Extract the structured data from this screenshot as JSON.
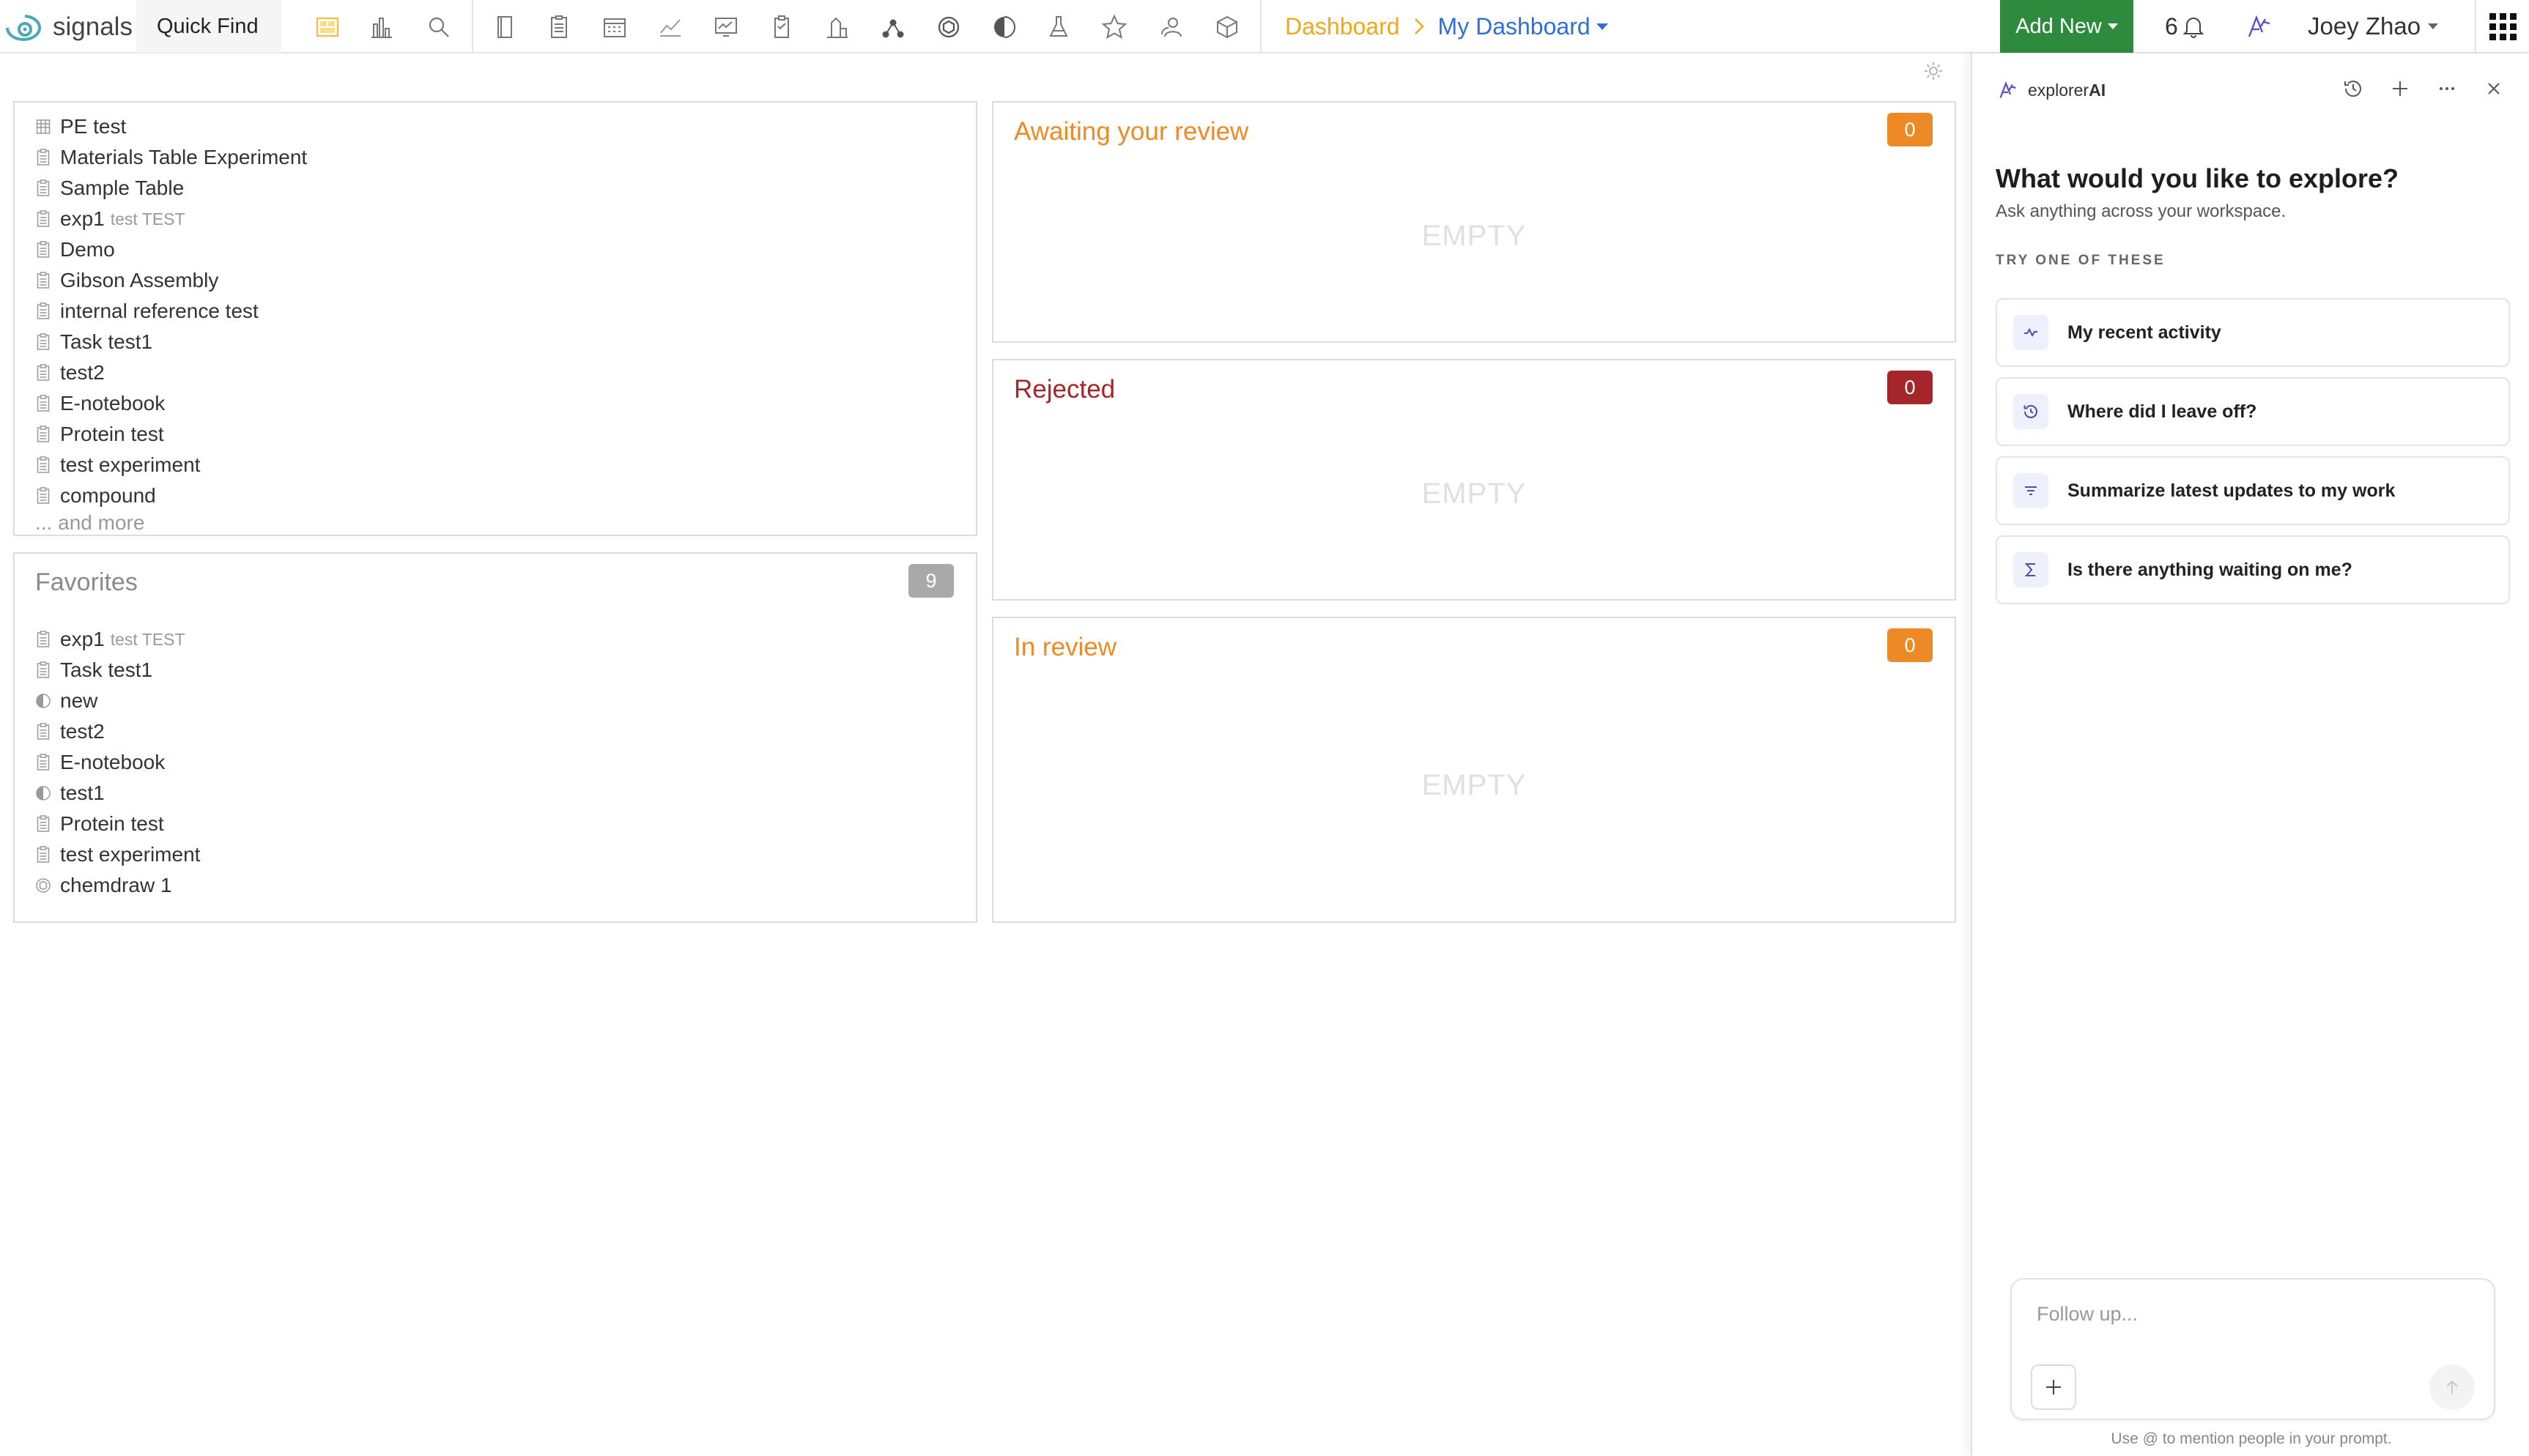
{
  "nav": {
    "brand": "signals",
    "quick_find": "Quick Find",
    "tools": [
      "dashboard-icon",
      "charts-icon",
      "search-icon",
      "notebook-icon",
      "experiment-icon",
      "calendar-icon",
      "analysis-icon",
      "presentation-icon",
      "clipboard-icon",
      "lab-icon",
      "network-icon",
      "chemistry-icon",
      "materials-icon",
      "flask-icon",
      "favorites-icon",
      "users-icon",
      "package-icon"
    ],
    "breadcrumb_root": "Dashboard",
    "breadcrumb_current": "My Dashboard",
    "add_new": "Add New",
    "notification_count": "6",
    "user_name": "Joey Zhao"
  },
  "recent": {
    "items": [
      {
        "label": "PE test",
        "sub": "",
        "icon": "table-icon"
      },
      {
        "label": "Materials Table Experiment",
        "sub": "",
        "icon": "experiment-icon"
      },
      {
        "label": "Sample Table",
        "sub": "",
        "icon": "experiment-icon"
      },
      {
        "label": "exp1",
        "sub": "test TEST",
        "icon": "experiment-icon"
      },
      {
        "label": "Demo",
        "sub": "",
        "icon": "experiment-icon"
      },
      {
        "label": "Gibson Assembly",
        "sub": "",
        "icon": "experiment-icon"
      },
      {
        "label": "internal reference test",
        "sub": "",
        "icon": "experiment-icon"
      },
      {
        "label": "Task test1",
        "sub": "",
        "icon": "experiment-icon"
      },
      {
        "label": "test2",
        "sub": "",
        "icon": "experiment-icon"
      },
      {
        "label": "E-notebook",
        "sub": "",
        "icon": "experiment-icon"
      },
      {
        "label": "Protein test",
        "sub": "",
        "icon": "experiment-icon"
      },
      {
        "label": "test experiment",
        "sub": "",
        "icon": "experiment-icon"
      },
      {
        "label": "compound",
        "sub": "",
        "icon": "experiment-icon"
      }
    ],
    "more_label": "... and more"
  },
  "favorites": {
    "title": "Favorites",
    "count": "9",
    "items": [
      {
        "label": "exp1",
        "sub": "test TEST",
        "icon": "experiment-icon"
      },
      {
        "label": "Task test1",
        "sub": "",
        "icon": "experiment-icon"
      },
      {
        "label": "new",
        "sub": "",
        "icon": "material-icon"
      },
      {
        "label": "test2",
        "sub": "",
        "icon": "experiment-icon"
      },
      {
        "label": "E-notebook",
        "sub": "",
        "icon": "experiment-icon"
      },
      {
        "label": "test1",
        "sub": "",
        "icon": "material-icon"
      },
      {
        "label": "Protein test",
        "sub": "",
        "icon": "experiment-icon"
      },
      {
        "label": "test experiment",
        "sub": "",
        "icon": "experiment-icon"
      },
      {
        "label": "chemdraw 1",
        "sub": "",
        "icon": "chemdraw-icon"
      }
    ]
  },
  "review": {
    "awaiting": {
      "title": "Awaiting your review",
      "count": "0",
      "empty": "EMPTY"
    },
    "rejected": {
      "title": "Rejected",
      "count": "0",
      "empty": "EMPTY"
    },
    "in_review": {
      "title": "In review",
      "count": "0",
      "empty": "EMPTY"
    }
  },
  "ai": {
    "brand_prefix": "explorer",
    "brand_suffix": "AI",
    "heading": "What would you like to explore?",
    "subheading": "Ask anything across your workspace.",
    "try_label": "TRY ONE OF THESE",
    "suggestions": [
      {
        "label": "My recent activity",
        "icon": "activity-icon"
      },
      {
        "label": "Where did I leave off?",
        "icon": "history-icon"
      },
      {
        "label": "Summarize latest updates to my work",
        "icon": "summary-icon"
      },
      {
        "label": "Is there anything waiting on me?",
        "icon": "sigma-icon"
      }
    ],
    "input_placeholder": "Follow up...",
    "input_value": "",
    "hint": "Use @ to mention people in your prompt."
  },
  "colors": {
    "accent_green": "#2e8b3d",
    "breadcrumb_root": "#f0a81a",
    "breadcrumb_current": "#2f6fd6",
    "badge_orange": "#ee8a26",
    "badge_red": "#a5262a",
    "badge_gray": "#a9a9a9"
  }
}
